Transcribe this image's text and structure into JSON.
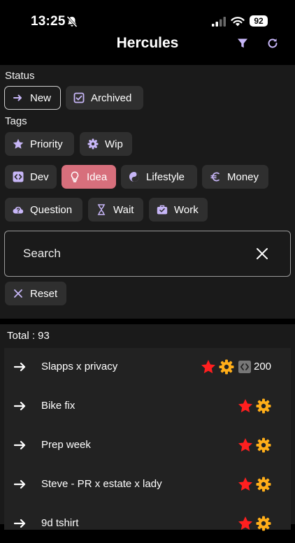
{
  "status_bar": {
    "time": "13:25",
    "battery": "92"
  },
  "nav": {
    "title": "Hercules",
    "filter_icon": "filter-icon",
    "refresh_icon": "refresh-icon"
  },
  "filters": {
    "status_label": "Status",
    "status_chips": [
      {
        "label": "New",
        "icon": "arrow-right-icon",
        "selected": true
      },
      {
        "label": "Archived",
        "icon": "checkbox-icon",
        "selected": false
      }
    ],
    "tags_label": "Tags",
    "tag_chips": [
      {
        "label": "Priority",
        "icon": "star-icon"
      },
      {
        "label": "Wip",
        "icon": "gear-icon"
      },
      {
        "label": "Dev",
        "icon": "code-icon"
      },
      {
        "label": "Idea",
        "icon": "lightbulb-icon",
        "selected": true,
        "color": "#d76f7c"
      },
      {
        "label": "Lifestyle",
        "icon": "yin-yang-icon"
      },
      {
        "label": "Money",
        "icon": "euro-icon"
      },
      {
        "label": "Question",
        "icon": "cloud-question-icon"
      },
      {
        "label": "Wait",
        "icon": "hourglass-icon"
      },
      {
        "label": "Work",
        "icon": "briefcase-icon"
      }
    ],
    "search_placeholder": "Search",
    "reset_label": "Reset"
  },
  "list": {
    "total_label": "Total : 93",
    "items": [
      {
        "title": "Slapps x privacy",
        "priority": true,
        "wip": true,
        "dev": true,
        "count": "200"
      },
      {
        "title": "Bike fix",
        "priority": true,
        "wip": true
      },
      {
        "title": "Prep week",
        "priority": true,
        "wip": true
      },
      {
        "title": "Steve - PR x estate x lady",
        "priority": true,
        "wip": true
      },
      {
        "title": "9d tshirt",
        "priority": true,
        "wip": true
      }
    ]
  },
  "colors": {
    "accent_icon": "#c7b6f7",
    "idea_chip": "#d76f7c",
    "star": "#ff1f1f",
    "gear": "#ffae19"
  }
}
